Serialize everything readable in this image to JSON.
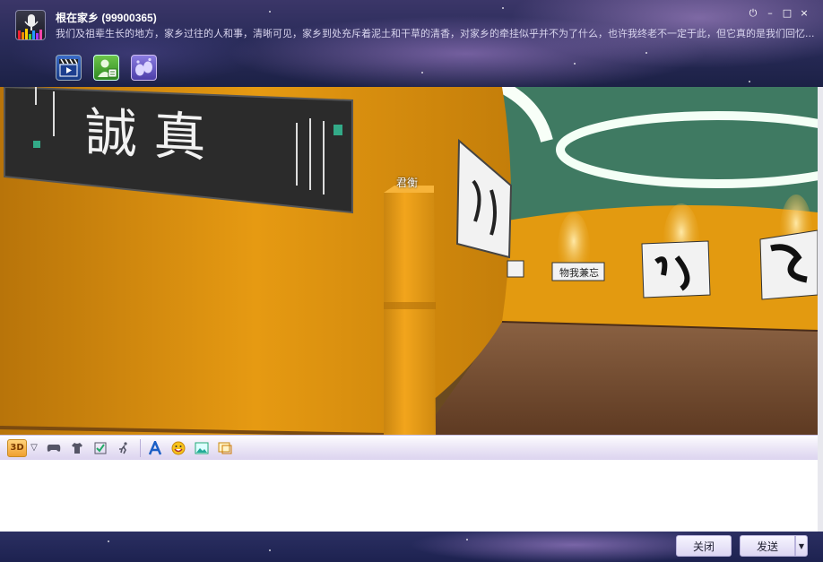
{
  "header": {
    "group_title": "根在家乡 (99900365)",
    "group_description": "我们及祖辈生长的地方，家乡过往的人和事，清晰可见，家乡到处充斥着泥土和干草的清香，对家乡的牵挂似乎并不为了什么，也许我终老不一定于此，但它真的是我们回忆...",
    "window_controls": {
      "power_icon": "⏻",
      "minimize_icon": "–",
      "maximize_icon": "□",
      "close_icon": "×"
    },
    "app_icons": [
      "video-icon",
      "member-card-icon",
      "footprint-icon"
    ]
  },
  "scene": {
    "avatar_name": "君衡",
    "calligraphy_1": "誠  真",
    "calligraphy_2": "物我兼忘",
    "colors": {
      "wall": "#e39a10",
      "floor": "#7a5030",
      "ceiling": "#3f7a62"
    }
  },
  "toolbar": {
    "mode_label": "3D",
    "dropdown_glyph": "▽",
    "items": [
      "gamepad-icon",
      "shirt-icon",
      "checklist-icon",
      "action-icon",
      "font-icon",
      "emoji-icon",
      "image-icon",
      "screenshot-icon"
    ]
  },
  "input": {
    "value": ""
  },
  "footer": {
    "close_label": "关闭",
    "send_label": "发送",
    "send_dropdown_glyph": "▼"
  }
}
